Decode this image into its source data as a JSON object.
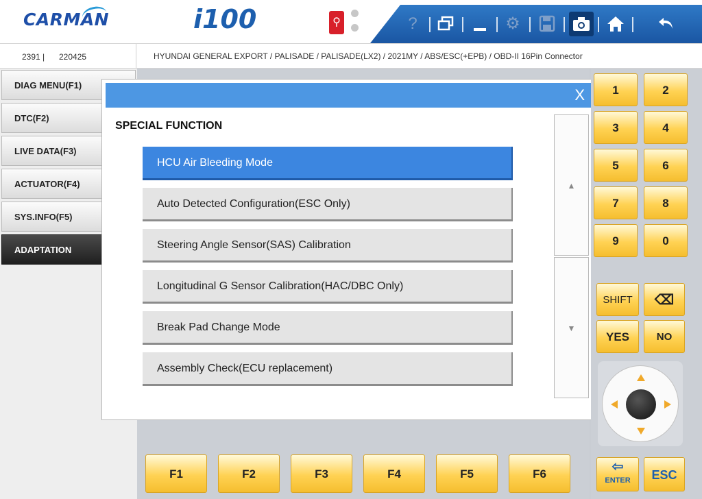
{
  "header": {
    "brand": "CARMAN",
    "model": "i100",
    "usb_icon": "usb-icon",
    "toolbar": {
      "help": "?",
      "icons": [
        "help-icon",
        "window-icon",
        "minimize-icon",
        "settings-icon",
        "save-icon",
        "camera-icon",
        "home-icon",
        "back-icon"
      ]
    }
  },
  "info": {
    "vehicle_code": "2391 |",
    "date": "220425",
    "path": "HYUNDAI GENERAL EXPORT / PALISADE / PALISADE(LX2) / 2021MY / ABS/ESC(+EPB) / OBD-II 16Pin Connector"
  },
  "sidebar": {
    "items": [
      {
        "label": "DIAG MENU(F1)"
      },
      {
        "label": "DTC(F2)"
      },
      {
        "label": "LIVE DATA(F3)"
      },
      {
        "label": "ACTUATOR(F4)"
      },
      {
        "label": "SYS.INFO(F5)"
      },
      {
        "label": "ADAPTATION"
      }
    ],
    "active_index": 5
  },
  "dialog": {
    "close": "X",
    "heading": "SPECIAL FUNCTION",
    "options": [
      {
        "label": "HCU Air Bleeding Mode"
      },
      {
        "label": "Auto Detected Configuration(ESC Only)"
      },
      {
        "label": "Steering Angle Sensor(SAS) Calibration"
      },
      {
        "label": "Longitudinal G Sensor Calibration(HAC/DBC Only)"
      },
      {
        "label": "Break Pad Change Mode"
      },
      {
        "label": "Assembly Check(ECU replacement)"
      }
    ],
    "selected_index": 0,
    "scroll_up": "▲",
    "scroll_down": "▼"
  },
  "keypad": {
    "digits": [
      "1",
      "2",
      "3",
      "4",
      "5",
      "6",
      "7",
      "8",
      "9",
      "0"
    ],
    "shift": "SHIFT",
    "backspace": "⌫",
    "yes": "YES",
    "no": "NO",
    "enter": "ENTER",
    "esc": "ESC"
  },
  "fkeys": [
    "F1",
    "F2",
    "F3",
    "F4",
    "F5",
    "F6"
  ],
  "colors": {
    "header_blue": "#1a56a3",
    "selected_blue": "#3c86e0",
    "key_yellow": "#ffd253",
    "dialog_title": "#4d97e3"
  }
}
